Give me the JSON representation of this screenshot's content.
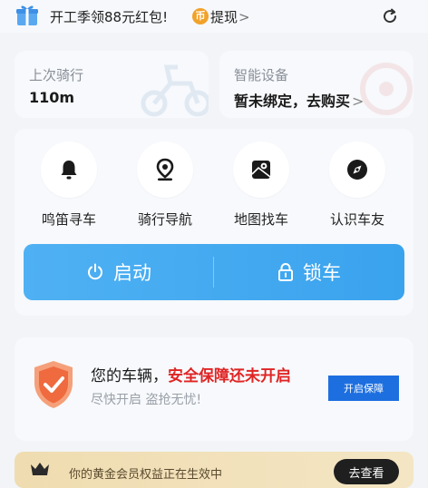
{
  "banner": {
    "text": "开工季领88元红包!",
    "coin_glyph": "币",
    "withdraw_label": "提现",
    "chevron": ">",
    "icons": {
      "gift": "gift-icon",
      "refresh": "refresh-icon"
    }
  },
  "ride_card": {
    "label": "上次骑行",
    "value": "110m"
  },
  "device_card": {
    "label": "智能设备",
    "value": "暂未绑定，去购买",
    "chevron": ">"
  },
  "actions": [
    {
      "label": "鸣笛寻车",
      "icon": "bell-icon"
    },
    {
      "label": "骑行导航",
      "icon": "location-pin-icon"
    },
    {
      "label": "地图找车",
      "icon": "map-icon"
    },
    {
      "label": "认识车友",
      "icon": "compass-icon"
    }
  ],
  "controls": {
    "start_label": "启动",
    "lock_label": "锁车",
    "color": "#3aa3ee"
  },
  "safety": {
    "title_prefix": "您的车辆，",
    "title_warning": "安全保障还未开启",
    "subtitle": "尽快开启  盗抢无忧!",
    "button_label": "开启保障",
    "warning_color": "#e02424",
    "button_color": "#1d6fe0"
  },
  "gold_member": {
    "text": "你的黄金会员权益正在生效中",
    "button_label": "去查看"
  }
}
